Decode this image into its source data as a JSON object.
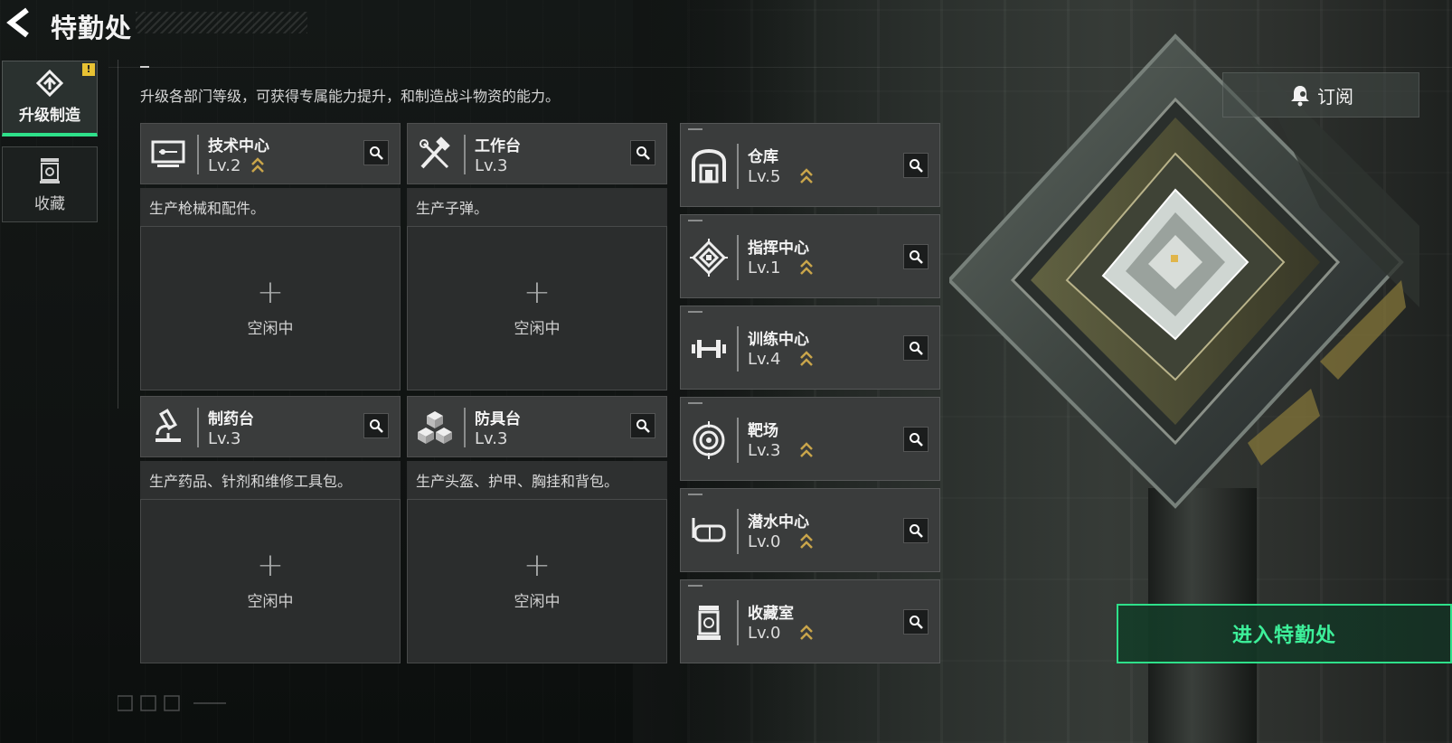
{
  "header": {
    "back_icon": "back-arrow-icon",
    "title": "特勤处"
  },
  "sidebar": {
    "tabs": [
      {
        "label": "升级制造",
        "icon": "upgrade-icon",
        "active": true,
        "badge": "!"
      },
      {
        "label": "收藏",
        "icon": "collection-icon",
        "active": false
      }
    ]
  },
  "intro_text": "升级各部门等级，可获得专属能力提升，和制造战斗物资的能力。",
  "subscribe": {
    "label": "订阅",
    "icon": "subscribe-bell-icon"
  },
  "facilities": [
    {
      "name": "技术中心",
      "level": "Lv.2",
      "icon": "computer-icon",
      "desc": "生产枪械和配件。",
      "slot_status": "空闲中"
    },
    {
      "name": "工作台",
      "level": "Lv.3",
      "icon": "tools-icon",
      "desc": "生产子弹。",
      "slot_status": "空闲中"
    },
    {
      "name": "制药台",
      "level": "Lv.3",
      "icon": "microscope-icon",
      "desc": "生产药品、针剂和维修工具包。",
      "slot_status": "空闲中"
    },
    {
      "name": "防具台",
      "level": "Lv.3",
      "icon": "cubes-icon",
      "desc": "生产头盔、护甲、胸挂和背包。",
      "slot_status": "空闲中"
    }
  ],
  "departments": [
    {
      "name": "仓库",
      "level": "Lv.5",
      "icon": "warehouse-icon"
    },
    {
      "name": "指挥中心",
      "level": "Lv.1",
      "icon": "chip-icon"
    },
    {
      "name": "训练中心",
      "level": "Lv.4",
      "icon": "dumbbell-icon"
    },
    {
      "name": "靶场",
      "level": "Lv.3",
      "icon": "target-icon"
    },
    {
      "name": "潜水中心",
      "level": "Lv.0",
      "icon": "diving-mask-icon"
    },
    {
      "name": "收藏室",
      "level": "Lv.0",
      "icon": "display-case-icon"
    }
  ],
  "enter_button": "进入特勤处",
  "colors": {
    "accent_green": "#2ee08a",
    "upgrade_gold": "#c9a54a",
    "badge_yellow": "#e8c233"
  }
}
